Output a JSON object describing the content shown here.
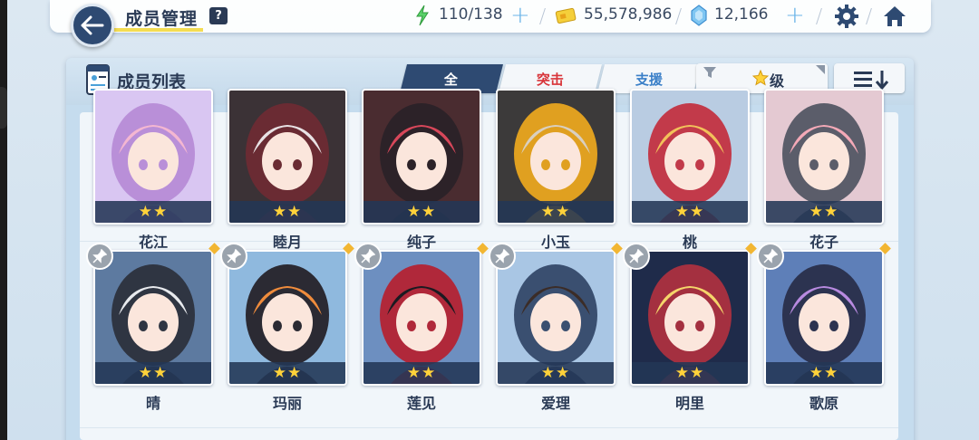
{
  "header": {
    "title": "成员管理",
    "help_label": "?",
    "stamina": "110/138",
    "credits": "55,578,986",
    "gems": "12,166",
    "plus_label": "+"
  },
  "list": {
    "title": "成员列表",
    "tabs": [
      {
        "label": "全",
        "active": true
      },
      {
        "label": "突击",
        "active": false
      },
      {
        "label": "支援",
        "active": false
      }
    ],
    "sort_label": "级",
    "colors": {
      "accent": "#2e4a72",
      "red": "#d8353a",
      "blue": "#3a7fc8",
      "star": "#ffd23a"
    }
  },
  "members": [
    {
      "name": "花江",
      "stars": "★★",
      "pinned": false
    },
    {
      "name": "睦月",
      "stars": "★★",
      "pinned": false
    },
    {
      "name": "纯子",
      "stars": "★★",
      "pinned": false
    },
    {
      "name": "小玉",
      "stars": "★★",
      "pinned": false
    },
    {
      "name": "桃",
      "stars": "★★",
      "pinned": false
    },
    {
      "name": "花子",
      "stars": "★★",
      "pinned": false
    },
    {
      "name": "晴",
      "stars": "★★",
      "pinned": true
    },
    {
      "name": "玛丽",
      "stars": "★★",
      "pinned": true
    },
    {
      "name": "莲见",
      "stars": "★★",
      "pinned": true
    },
    {
      "name": "爱理",
      "stars": "★★",
      "pinned": true
    },
    {
      "name": "明里",
      "stars": "★★",
      "pinned": true
    },
    {
      "name": "歌原",
      "stars": "★★",
      "pinned": true
    }
  ]
}
